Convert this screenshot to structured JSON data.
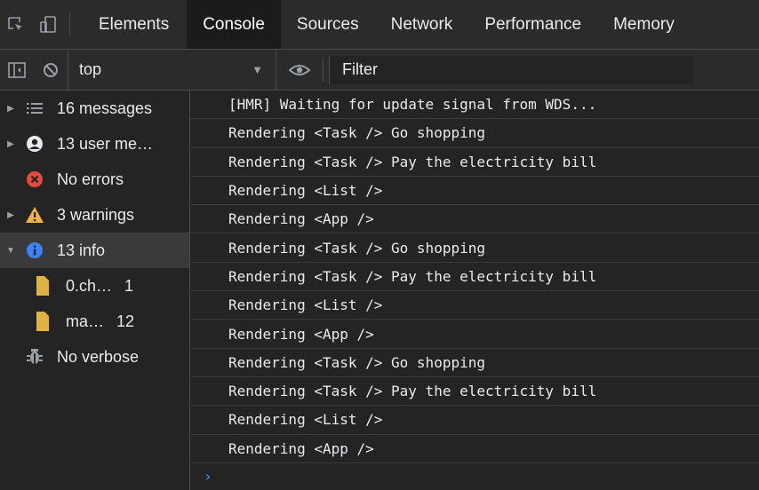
{
  "tabs": [
    "Elements",
    "Console",
    "Sources",
    "Network",
    "Performance",
    "Memory"
  ],
  "active_tab": "Console",
  "toolbar": {
    "context": "top",
    "filter_placeholder": "Filter"
  },
  "sidebar": {
    "items": [
      {
        "label": "16 messages",
        "icon": "list-icon"
      },
      {
        "label": "13 user me…",
        "icon": "user-icon"
      },
      {
        "label": "No errors",
        "icon": "error-icon"
      },
      {
        "label": "3 warnings",
        "icon": "warning-icon"
      },
      {
        "label": "13 info",
        "icon": "info-icon"
      }
    ],
    "info_files": [
      {
        "name": "0.ch…",
        "count": "1"
      },
      {
        "name": "ma…",
        "count": "12"
      }
    ],
    "verbose": {
      "label": "No verbose",
      "icon": "bug-icon"
    }
  },
  "console": {
    "lines": [
      "[HMR] Waiting for update signal from WDS...",
      "Rendering <Task /> Go shopping",
      "Rendering <Task /> Pay the electricity bill",
      "Rendering <List />",
      "Rendering <App />",
      "Rendering <Task /> Go shopping",
      "Rendering <Task /> Pay the electricity bill",
      "Rendering <List />",
      "Rendering <App />",
      "Rendering <Task /> Go shopping",
      "Rendering <Task /> Pay the electricity bill",
      "Rendering <List />",
      "Rendering <App />"
    ],
    "prompt": "›"
  },
  "colors": {
    "error": "#e44b3c",
    "warning": "#f2b33d",
    "info": "#3a82f7",
    "file": "#e0b23f"
  }
}
